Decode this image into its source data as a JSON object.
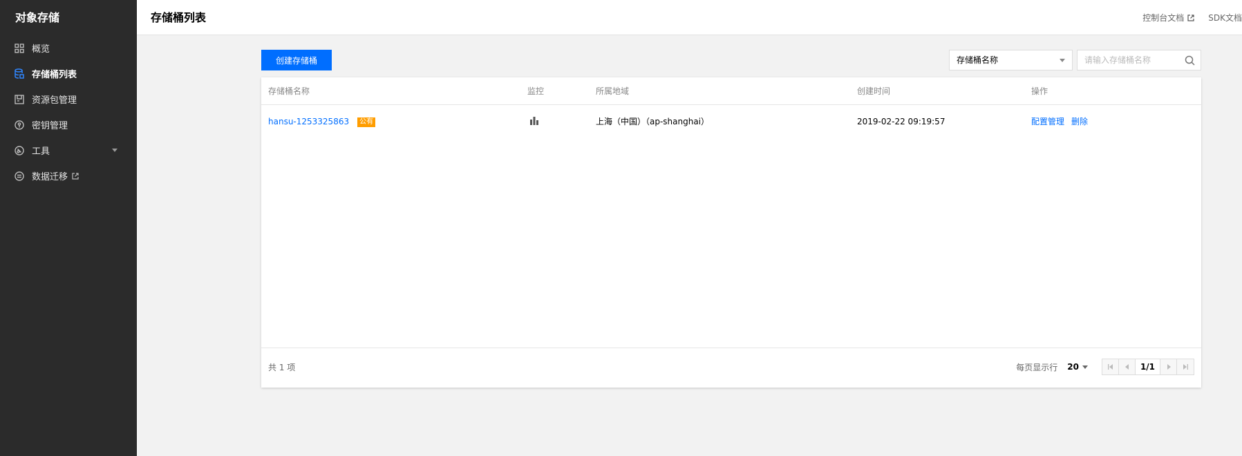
{
  "sidebar": {
    "brand": "对象存储",
    "items": [
      {
        "label": "概览",
        "icon": "overview-grid-icon"
      },
      {
        "label": "存储桶列表",
        "icon": "bucket-list-icon"
      },
      {
        "label": "资源包管理",
        "icon": "resource-package-icon"
      },
      {
        "label": "密钥管理",
        "icon": "key-icon"
      },
      {
        "label": "工具",
        "icon": "tools-icon"
      },
      {
        "label": "数据迁移",
        "icon": "migration-icon"
      }
    ],
    "active_item": "存储桶列表"
  },
  "header": {
    "title": "存储桶列表",
    "links": [
      {
        "label": "控制台文档"
      },
      {
        "label": "SDK文档"
      }
    ]
  },
  "toolbar": {
    "create_label": "创建存储桶",
    "filter_selected": "存储桶名称",
    "search_placeholder": "请输入存储桶名称"
  },
  "table": {
    "columns": [
      "存储桶名称",
      "监控",
      "所属地域",
      "创建时间",
      "操作"
    ],
    "rows": [
      {
        "name": "hansu-1253325863",
        "badge": "公有",
        "region": "上海（中国）（ap-shanghai）",
        "created": "2019-02-22 09:19:57",
        "actions": [
          "配置管理",
          "删除"
        ]
      }
    ]
  },
  "footer": {
    "total": "共 1 项",
    "per_page_label": "每页显示行",
    "per_page_value": "20",
    "page": "1/1"
  },
  "colors": {
    "accent": "#006eff",
    "sidebar_bg": "#2b2b2b",
    "badge": "#ff9d00"
  }
}
